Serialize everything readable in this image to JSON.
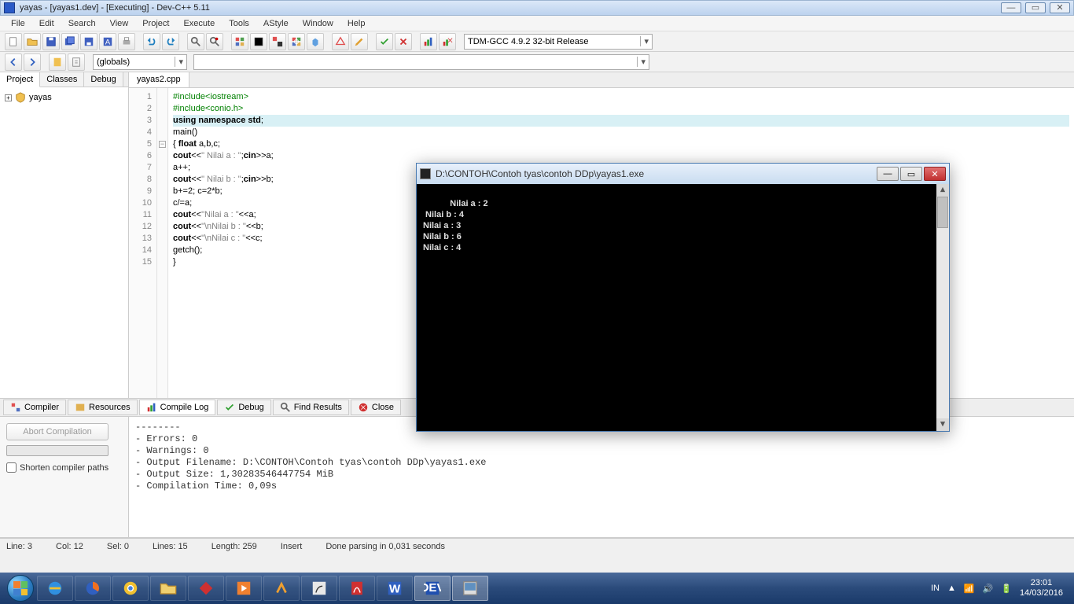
{
  "title": "yayas - [yayas1.dev] - [Executing] - Dev-C++ 5.11",
  "menus": [
    "File",
    "Edit",
    "Search",
    "View",
    "Project",
    "Execute",
    "Tools",
    "AStyle",
    "Window",
    "Help"
  ],
  "compiler_combo": "TDM-GCC 4.9.2 32-bit Release",
  "scope_combo": "(globals)",
  "side_tabs": [
    "Project",
    "Classes",
    "Debug"
  ],
  "project_root": "yayas",
  "editor_tab": "yayas2.cpp",
  "code": {
    "lines": [
      {
        "n": "1",
        "raw": "#include<iostream>",
        "cls": "pp"
      },
      {
        "n": "2",
        "raw": "#include<conio.h>",
        "cls": "pp"
      },
      {
        "n": "3",
        "raw": "using namespace std;",
        "cls": "kw",
        "hl": true
      },
      {
        "n": "4",
        "raw": "main()",
        "cls": ""
      },
      {
        "n": "5",
        "raw": "{ float a,b,c;",
        "cls": "",
        "fold": true
      },
      {
        "n": "6",
        "raw": "cout<<\" Nilai a : \";cin>>a;",
        "cls": ""
      },
      {
        "n": "7",
        "raw": "a++;",
        "cls": ""
      },
      {
        "n": "8",
        "raw": "cout<<\" Nilai b : \";cin>>b;",
        "cls": ""
      },
      {
        "n": "9",
        "raw": "b+=2; c=2*b;",
        "cls": ""
      },
      {
        "n": "10",
        "raw": "c/=a;",
        "cls": ""
      },
      {
        "n": "11",
        "raw": "cout<<\"Nilai a : \"<<a;",
        "cls": ""
      },
      {
        "n": "12",
        "raw": "cout<<\"\\nNilai b : \"<<b;",
        "cls": ""
      },
      {
        "n": "13",
        "raw": "cout<<\"\\nNilai c : \"<<c;",
        "cls": ""
      },
      {
        "n": "14",
        "raw": "getch();",
        "cls": ""
      },
      {
        "n": "15",
        "raw": "}",
        "cls": ""
      }
    ]
  },
  "bottom_tabs": [
    "Compiler",
    "Resources",
    "Compile Log",
    "Debug",
    "Find Results",
    "Close"
  ],
  "bottom_active": 2,
  "abort_btn": "Abort Compilation",
  "shorten_label": "Shorten compiler paths",
  "compile_log": "--------\n- Errors: 0\n- Warnings: 0\n- Output Filename: D:\\CONTOH\\Contoh tyas\\contoh DDp\\yayas1.exe\n- Output Size: 1,30283546447754 MiB\n- Compilation Time: 0,09s",
  "status": {
    "line": "Line:   3",
    "col": "Col:   12",
    "sel": "Sel:   0",
    "lines": "Lines:   15",
    "length": "Length:   259",
    "mode": "Insert",
    "msg": "Done parsing in 0,031 seconds"
  },
  "console": {
    "title": "D:\\CONTOH\\Contoh tyas\\contoh DDp\\yayas1.exe",
    "out": " Nilai a : 2\n Nilai b : 4\nNilai a : 3\nNilai b : 6\nNilai c : 4"
  },
  "tray": {
    "lang": "IN",
    "time": "23:01",
    "date": "14/03/2016"
  }
}
